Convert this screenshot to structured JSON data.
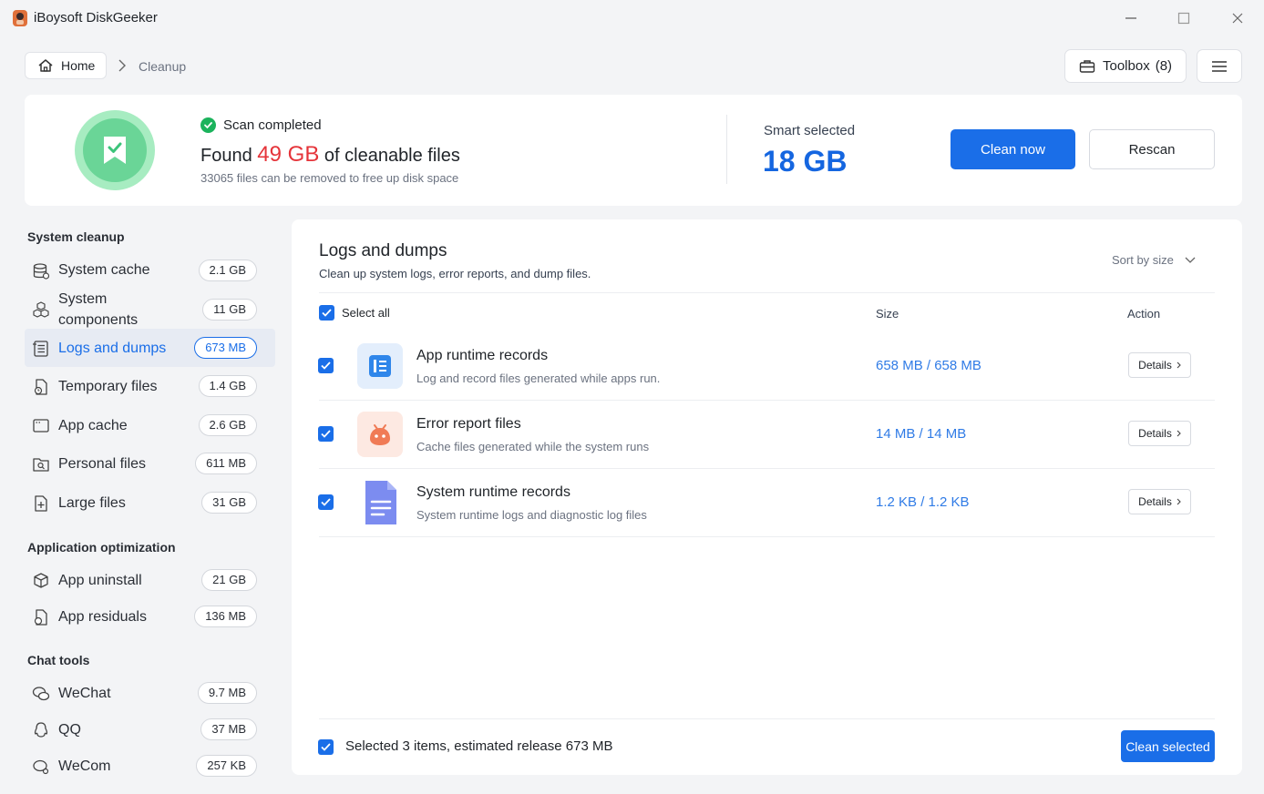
{
  "window": {
    "title": "iBoysoft DiskGeeker"
  },
  "breadcrumb": {
    "home": "Home",
    "current": "Cleanup"
  },
  "header": {
    "toolbox_label": "Toolbox",
    "toolbox_count": "(8)"
  },
  "summary": {
    "status": "Scan completed",
    "found_prefix": "Found",
    "found_value": "49 GB",
    "found_suffix": "of cleanable files",
    "subtitle": "33065 files can be removed to free up disk space",
    "smart_label": "Smart selected",
    "smart_value": "18 GB",
    "clean_now": "Clean now",
    "rescan": "Rescan"
  },
  "sidebar": {
    "sections": [
      {
        "title": "System cleanup"
      },
      {
        "title": "Application optimization"
      },
      {
        "title": "Chat tools"
      }
    ],
    "items": [
      {
        "label": "System cache",
        "size": "2.1 GB"
      },
      {
        "label": "System",
        "label2": "components",
        "size": "11 GB"
      },
      {
        "label": "Logs and dumps",
        "size": "673 MB",
        "active": true
      },
      {
        "label": "Temporary files",
        "size": "1.4 GB"
      },
      {
        "label": "App cache",
        "size": "2.6 GB"
      },
      {
        "label": "Personal files",
        "size": "611 MB"
      },
      {
        "label": "Large files",
        "size": "31 GB"
      },
      {
        "label": "App uninstall",
        "size": "21 GB"
      },
      {
        "label": "App residuals",
        "size": "136 MB"
      },
      {
        "label": "WeChat",
        "size": "9.7 MB"
      },
      {
        "label": "QQ",
        "size": "37 MB"
      },
      {
        "label": "WeCom",
        "size": "257 KB"
      }
    ]
  },
  "panel": {
    "title": "Logs and dumps",
    "subtitle": "Clean up system logs, error reports, and dump files.",
    "sort": "Sort by size",
    "select_all": "Select all",
    "col_size": "Size",
    "col_action": "Action",
    "rows": [
      {
        "name": "App runtime records",
        "desc": "Log and record files generated while apps run.",
        "size": "658 MB / 658 MB",
        "action": "Details"
      },
      {
        "name": "Error report files",
        "desc": "Cache files generated while the system runs",
        "size": "14 MB / 14 MB",
        "action": "Details"
      },
      {
        "name": "System runtime records",
        "desc": "System runtime logs and diagnostic log files",
        "size": "1.2 KB / 1.2 KB",
        "action": "Details"
      }
    ],
    "footer_text": "Selected 3 items, estimated release 673 MB",
    "clean_selected": "Clean selected"
  },
  "colors": {
    "accent": "#1a6ee8",
    "found": "#e5343a",
    "success": "#1bb35c"
  }
}
